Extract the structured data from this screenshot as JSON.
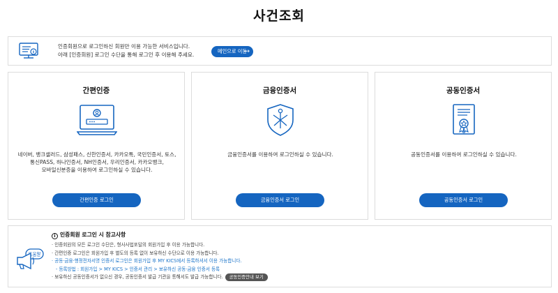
{
  "page": {
    "title": "사건조회"
  },
  "notice": {
    "line1": "인증회원으로 로그인하신 회원만 이용 가능한 서비스입니다.",
    "line2": "아래 [인증회원] 로그인 수단을 통해 로그인 후 이용해 주세요.",
    "main_button": "메인으로 이동",
    "icon": "computer-info-icon"
  },
  "cards": [
    {
      "title": "간편인증",
      "icon": "laptop-login-icon",
      "desc_lines": [
        "네이버, 뱅크샐러드, 삼성패스, 신한인증서, 카카오톡, 국민인증서, 토스,",
        "통신PASS, 하나인증서, NH인증서, 우리인증서, 카카오뱅크,",
        "모바일신분증을 이용하여 로그인하실 수 있습니다."
      ],
      "button": "간편인증 로그인"
    },
    {
      "title": "금융인증서",
      "icon": "shield-icon",
      "desc_lines": [
        "금융인증서를 이용하여 로그인하실 수 있습니다."
      ],
      "button": "금융인증서 로그인"
    },
    {
      "title": "공동인증서",
      "icon": "certificate-icon",
      "desc_lines": [
        "공동인증서를 이용하여 로그인하실 수 있습니다."
      ],
      "button": "공동인증서 로그인"
    }
  ],
  "info": {
    "icon": "megaphone-icon",
    "icon_label": "도움말",
    "heading": "인증회원 로그인 시 참고사항",
    "items": [
      "· 인증회원의 모든 로그인 수단은, 형사사법포털의 회원가입 후 이용 가능합니다.",
      "· 간편인증 로그인은 회원가입 후 별도의 등록 없이 보유하신 수단으로 이용 가능합니다.",
      "· 공동·금융·행정전자서명 인증서 로그인은 회원가입 후 MY KICS에서 등록하셔서 이용 가능합니다.",
      "- 등록방법 : 회원가입 > MY KICS > 인증서 관리 > 보유하신 공동·금융 인증서 등록",
      "· 보유하신 공동인증서가 없으신 경우, 공동인증서 발급 기관을 통해서도 발급 가능합니다."
    ],
    "guide_button": "공동인증안내 보기"
  }
}
